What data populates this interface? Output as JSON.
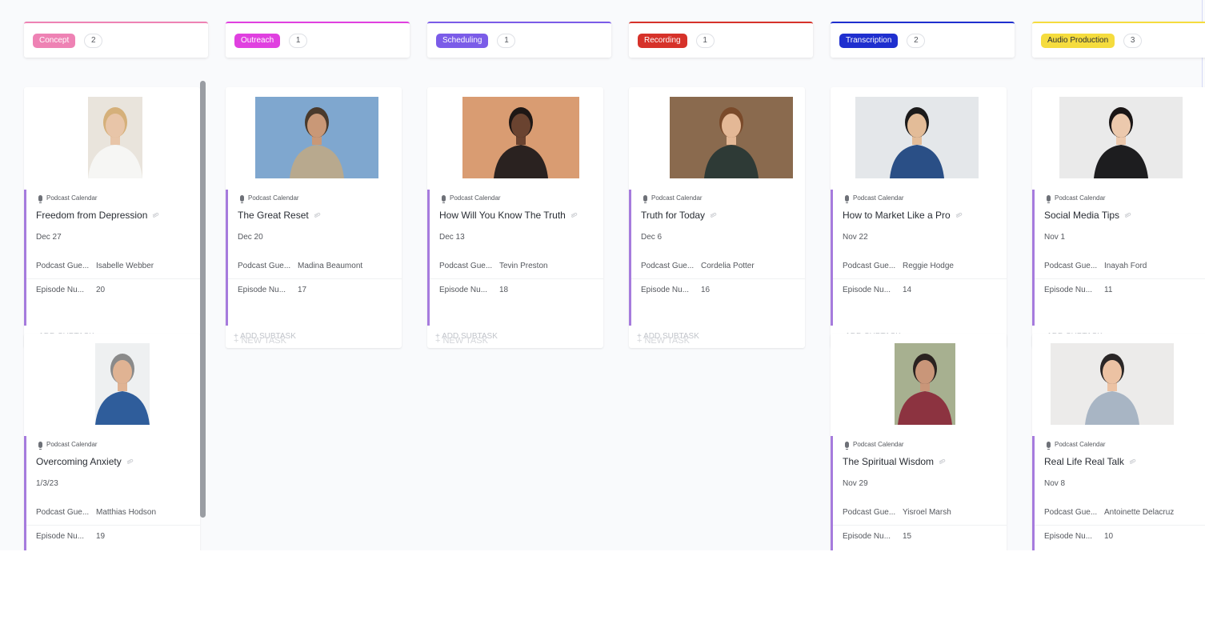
{
  "columns": [
    {
      "status": "Concept",
      "status_color": "#ee82b4",
      "border_color": "#ee82b4",
      "count": "2",
      "cards": [
        {
          "list": "Podcast Calendar",
          "title": "Freedom from Depression",
          "date": "Dec 27",
          "guest_label": "Podcast Gue...",
          "guest": "Isabelle Webber",
          "episode_label": "Episode Nu...",
          "episode": "20",
          "footer": "+ ADD SUBTASK",
          "photo": {
            "bg": "#e9e4dc",
            "shirt": "#f6f6f4",
            "skin": "#e8c5a8",
            "hair": "#d5b07a"
          }
        },
        {
          "list": "Podcast Calendar",
          "title": "Overcoming Anxiety",
          "date": "1/3/23",
          "guest_label": "Podcast Gue...",
          "guest": "Matthias Hodson",
          "episode_label": "Episode Nu...",
          "episode": "19",
          "footer": "",
          "photo": {
            "bg": "#eef0f1",
            "shirt": "#2f5d9b",
            "skin": "#e0b393",
            "hair": "#8a8a8a"
          }
        }
      ],
      "new_task": ""
    },
    {
      "status": "Outreach",
      "status_color": "#e040e0",
      "border_color": "#e040e0",
      "count": "1",
      "cards": [
        {
          "list": "Podcast Calendar",
          "title": "The Great Reset",
          "date": "Dec 20",
          "guest_label": "Podcast Gue...",
          "guest": "Madina Beaumont",
          "episode_label": "Episode Nu...",
          "episode": "17",
          "footer": "+ ADD SUBTASK",
          "photo": {
            "bg": "#7fa7cf",
            "shirt": "#b8a98e",
            "skin": "#c99877",
            "hair": "#4a3a2c"
          }
        }
      ],
      "new_task": "+ NEW TASK"
    },
    {
      "status": "Scheduling",
      "status_color": "#7b5ce8",
      "border_color": "#7b5ce8",
      "count": "1",
      "cards": [
        {
          "list": "Podcast Calendar",
          "title": "How Will You Know The Truth",
          "date": "Dec 13",
          "guest_label": "Podcast Gue...",
          "guest": "Tevin Preston",
          "episode_label": "Episode Nu...",
          "episode": "18",
          "footer": "+ ADD SUBTASK",
          "photo": {
            "bg": "#d99c72",
            "shirt": "#2a2220",
            "skin": "#6a4330",
            "hair": "#1e1715"
          }
        }
      ],
      "new_task": "+ NEW TASK"
    },
    {
      "status": "Recording",
      "status_color": "#d6322a",
      "border_color": "#d6322a",
      "count": "1",
      "cards": [
        {
          "list": "Podcast Calendar",
          "title": "Truth for Today",
          "date": "Dec 6",
          "guest_label": "Podcast Gue...",
          "guest": "Cordelia Potter",
          "episode_label": "Episode Nu...",
          "episode": "16",
          "footer": "+ ADD SUBTASK",
          "photo": {
            "bg": "#8a6a4e",
            "shirt": "#2e3a36",
            "skin": "#e4b896",
            "hair": "#7a4a2a"
          }
        }
      ],
      "new_task": "+ NEW TASK"
    },
    {
      "status": "Transcription",
      "status_color": "#1f2fcf",
      "border_color": "#1f2fcf",
      "count": "2",
      "cards": [
        {
          "list": "Podcast Calendar",
          "title": "How to Market Like a Pro",
          "date": "Nov 22",
          "guest_label": "Podcast Gue...",
          "guest": "Reggie Hodge",
          "episode_label": "Episode Nu...",
          "episode": "14",
          "footer": "+ ADD SUBTASK",
          "photo": {
            "bg": "#e4e7ea",
            "shirt": "#2a4f86",
            "skin": "#e3bc98",
            "hair": "#1c1b1b"
          }
        },
        {
          "list": "Podcast Calendar",
          "title": "The Spiritual Wisdom",
          "date": "Nov 29",
          "guest_label": "Podcast Gue...",
          "guest": "Yisroel Marsh",
          "episode_label": "Episode Nu...",
          "episode": "15",
          "footer": "",
          "photo": {
            "bg": "#a7b090",
            "shirt": "#8c3340",
            "skin": "#c99679",
            "hair": "#2a2220"
          }
        }
      ],
      "new_task": ""
    },
    {
      "status": "Audio Production",
      "status_color": "#f5dc3e",
      "border_color": "#f5dc3e",
      "count": "3",
      "status_text_color": "#292d34",
      "cards": [
        {
          "list": "Podcast Calendar",
          "title": "Social Media Tips",
          "date": "Nov 1",
          "guest_label": "Podcast Gue...",
          "guest": "Inayah Ford",
          "episode_label": "Episode Nu...",
          "episode": "11",
          "footer": "+ ADD SUBTASK",
          "photo": {
            "bg": "#eaeaea",
            "shirt": "#1d1d1f",
            "skin": "#ecc9ad",
            "hair": "#1a1616"
          }
        },
        {
          "list": "Podcast Calendar",
          "title": "Real Life Real Talk",
          "date": "Nov 8",
          "guest_label": "Podcast Gue...",
          "guest": "Antoinette Delacruz",
          "episode_label": "Episode Nu...",
          "episode": "10",
          "footer": "",
          "photo": {
            "bg": "#ecebea",
            "shirt": "#a8b5c4",
            "skin": "#ecc2a3",
            "hair": "#2a2626"
          }
        }
      ],
      "new_task": ""
    }
  ]
}
